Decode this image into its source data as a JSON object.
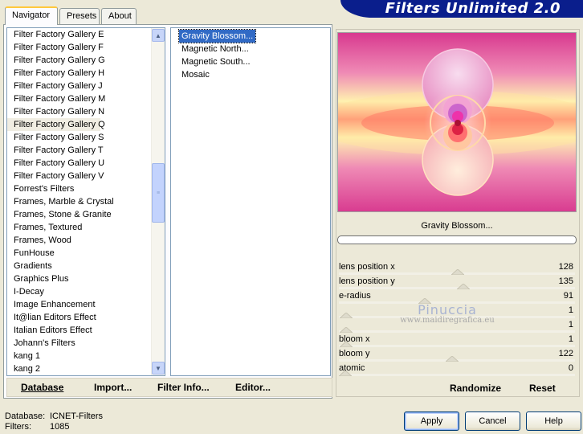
{
  "tabs": [
    {
      "label": "Navigator",
      "active": true
    },
    {
      "label": "Presets",
      "active": false
    },
    {
      "label": "About",
      "active": false
    }
  ],
  "banner_title": "Filters Unlimited 2.0",
  "categories": [
    "Filter Factory Gallery E",
    "Filter Factory Gallery F",
    "Filter Factory Gallery G",
    "Filter Factory Gallery H",
    "Filter Factory Gallery J",
    "Filter Factory Gallery M",
    "Filter Factory Gallery N",
    "Filter Factory Gallery Q",
    "Filter Factory Gallery S",
    "Filter Factory Gallery T",
    "Filter Factory Gallery U",
    "Filter Factory Gallery V",
    "Forrest's Filters",
    "Frames, Marble & Crystal",
    "Frames, Stone & Granite",
    "Frames, Textured",
    "Frames, Wood",
    "FunHouse",
    "Gradients",
    "Graphics Plus",
    "I-Decay",
    "Image Enhancement",
    "It@lian Editors Effect",
    "Italian Editors Effect",
    "Johann's Filters",
    "kang 1",
    "kang 2"
  ],
  "selected_category_index": 7,
  "filters": [
    "Gravity Blossom...",
    "Magnetic North...",
    "Magnetic South...",
    "Mosaic"
  ],
  "selected_filter_index": 0,
  "left_buttons": {
    "database": "Database",
    "import": "Import...",
    "filter_info": "Filter Info...",
    "editor": "Editor..."
  },
  "filter_name": "Gravity Blossom...",
  "progress": 0,
  "params": [
    {
      "name": "lens position x",
      "value": "128",
      "slider": 128
    },
    {
      "name": "lens position y",
      "value": "135",
      "slider": 135
    },
    {
      "name": "e-radius",
      "value": "91",
      "slider": 91
    },
    {
      "name": "",
      "value": "1",
      "slider": 1
    },
    {
      "name": "",
      "value": "1",
      "slider": 1
    },
    {
      "name": "bloom x",
      "value": "1",
      "slider": 1
    },
    {
      "name": "bloom y",
      "value": "122",
      "slider": 122
    },
    {
      "name": "atomic",
      "value": "0",
      "slider": 0
    }
  ],
  "slider_max": 255,
  "watermark": {
    "line1": "Pinuccia",
    "line2": "www.maidiregrafica.eu"
  },
  "randomize_label": "Randomize",
  "reset_label": "Reset",
  "status": {
    "db_label": "Database:",
    "db_value": "ICNET-Filters",
    "filters_label": "Filters:",
    "filters_value": "1085"
  },
  "dialog_buttons": {
    "apply": "Apply",
    "cancel": "Cancel",
    "help": "Help"
  }
}
